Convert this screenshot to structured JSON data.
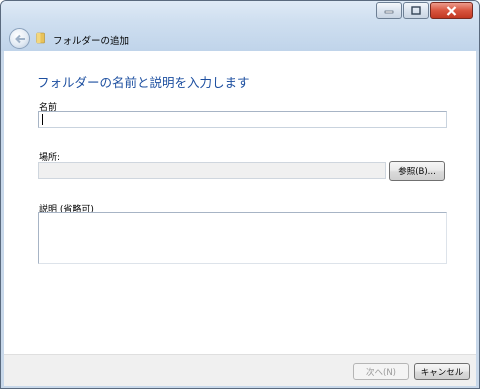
{
  "window": {
    "title": "フォルダーの追加",
    "controls": [
      "minimize-icon",
      "maximize-icon",
      "close-icon"
    ]
  },
  "main": {
    "heading": "フォルダーの名前と説明を入力します",
    "name_label": "名前",
    "name_value": "",
    "location_label": "場所:",
    "location_value": "",
    "browse_label": "参照(B)...",
    "description_label": "説明 (省略可)",
    "description_value": ""
  },
  "footer": {
    "next_label": "次へ(N)",
    "cancel_label": "キャンセル"
  },
  "colors": {
    "heading": "#1d4fa0",
    "titlebar": "#cfdff0",
    "close": "#d8553f"
  }
}
